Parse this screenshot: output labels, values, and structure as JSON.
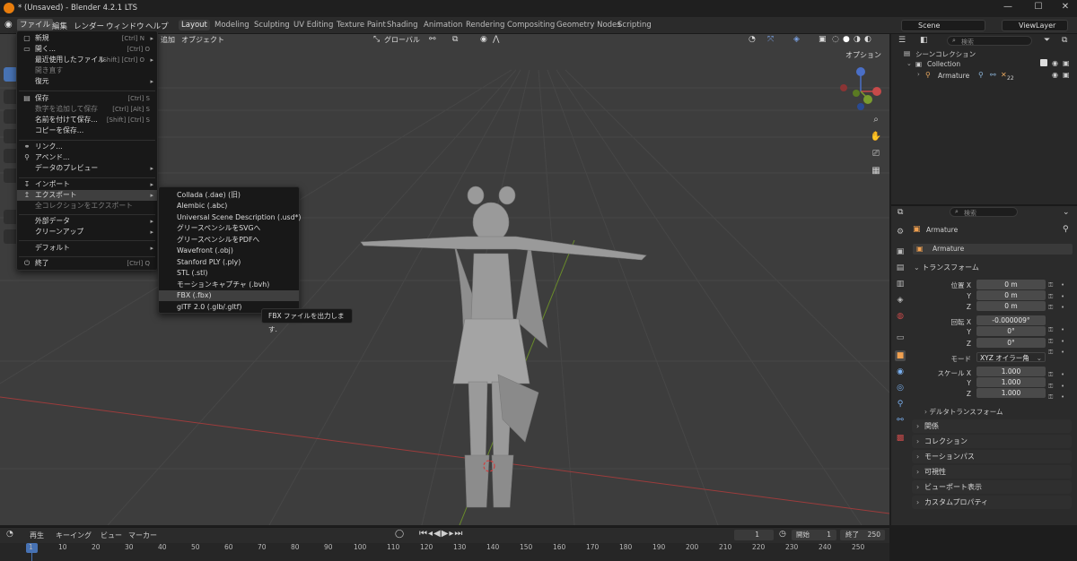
{
  "titlebar": {
    "title": "* (Unsaved) - Blender 4.2.1 LTS",
    "min": "—",
    "max": "☐",
    "close": "✕"
  },
  "topmenu": [
    "ファイル",
    "編集",
    "レンダー",
    "ウィンドウ",
    "ヘルプ"
  ],
  "workspaces": [
    "Layout",
    "Modeling",
    "Sculpting",
    "UV Editing",
    "Texture Paint",
    "Shading",
    "Animation",
    "Rendering",
    "Compositing",
    "Geometry Nodes",
    "Scripting"
  ],
  "scene": {
    "name": "Scene",
    "view_layer": "ViewLayer"
  },
  "viewport": {
    "header_items": [
      "追加",
      "オブジェクト"
    ],
    "orientation": "グローバル",
    "options_label": "オプション"
  },
  "file_menu": [
    {
      "label": "新規",
      "shortcut": "[Ctrl] N",
      "arrow": "▸",
      "icon": "▢"
    },
    {
      "label": "開く...",
      "shortcut": "[Ctrl] O",
      "icon": "▭"
    },
    {
      "label": "最近使用したファイル",
      "shortcut": "[Shift] [Ctrl] O",
      "arrow": "▸"
    },
    {
      "label": "開き直す",
      "disabled": true
    },
    {
      "label": "復元",
      "arrow": "▸"
    },
    {
      "label": "保存",
      "shortcut": "[Ctrl] S",
      "icon": "▤"
    },
    {
      "label": "数字を追加して保存",
      "shortcut": "[Ctrl] [Alt] S",
      "disabled": true
    },
    {
      "label": "名前を付けて保存...",
      "shortcut": "[Shift] [Ctrl] S"
    },
    {
      "label": "コピーを保存..."
    },
    {
      "label": "リンク...",
      "icon": "⚭"
    },
    {
      "label": "アペンド...",
      "icon": "⚲"
    },
    {
      "label": "データのプレビュー",
      "arrow": "▸"
    },
    {
      "label": "インポート",
      "arrow": "▸",
      "icon": "↧"
    },
    {
      "label": "エクスポート",
      "arrow": "▸",
      "icon": "↥",
      "highlight": true
    },
    {
      "label": "全コレクションをエクスポート",
      "disabled": true
    },
    {
      "label": "外部データ",
      "arrow": "▸"
    },
    {
      "label": "クリーンアップ",
      "arrow": "▸"
    },
    {
      "label": "デフォルト",
      "arrow": "▸"
    },
    {
      "label": "終了",
      "shortcut": "[Ctrl] Q",
      "icon": "⏻"
    }
  ],
  "export_menu": [
    "Collada (.dae) (旧)",
    "Alembic (.abc)",
    "Universal Scene Description (.usd*)",
    "グリースペンシルをSVGへ",
    "グリースペンシルをPDFへ",
    "Wavefront (.obj)",
    "Stanford PLY (.ply)",
    "STL (.stl)",
    "モーションキャプチャ (.bvh)",
    "FBX (.fbx)",
    "glTF 2.0 (.glb/.gltf)"
  ],
  "tooltip": "FBX ファイルを出力します.",
  "outliner": {
    "search_placeholder": "検索",
    "scene_collection": "シーンコレクション",
    "collection": "Collection",
    "armature": "Armature",
    "armature_count": "22"
  },
  "properties": {
    "search_placeholder": "検索",
    "object_name": "Armature",
    "datablock": "Armature",
    "transform_header": "トランスフォーム",
    "location_label": "位置 X",
    "rotation_label": "回転 X",
    "scale_label": "スケール X",
    "y_label": "Y",
    "z_label": "Z",
    "loc": [
      "0 m",
      "0 m",
      "0 m"
    ],
    "rot": [
      "-0.000009°",
      "0°",
      "0°"
    ],
    "mode_label": "モード",
    "mode_value": "XYZ オイラー角",
    "scale": [
      "1.000",
      "1.000",
      "1.000"
    ],
    "delta": "デルタトランスフォーム",
    "panels": [
      "関係",
      "コレクション",
      "モーションパス",
      "可視性",
      "ビューポート表示",
      "カスタムプロパティ"
    ]
  },
  "timeline": {
    "menus": [
      "再生",
      "キーイング",
      "ビュー",
      "マーカー"
    ],
    "current_frame": "1",
    "start_label": "開始",
    "start": "1",
    "end_label": "終了",
    "end": "250",
    "ticks": [
      "1",
      "10",
      "20",
      "30",
      "40",
      "50",
      "60",
      "70",
      "80",
      "90",
      "100",
      "110",
      "120",
      "130",
      "140",
      "150",
      "160",
      "170",
      "180",
      "190",
      "200",
      "210",
      "220",
      "230",
      "240",
      "250"
    ]
  },
  "colors": {
    "accent": "#4772b3",
    "x_axis": "#c74a4a",
    "y_axis": "#7a9c2e",
    "z_axis": "#2e62c7",
    "blender_orange": "#e87d0d"
  }
}
